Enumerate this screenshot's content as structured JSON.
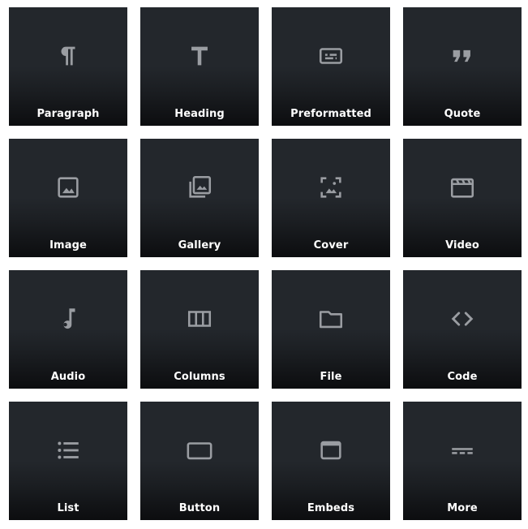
{
  "colors": {
    "tile_background": "#23272c",
    "tile_background_bottom": "#0c0d0f",
    "icon": "#9a9da2",
    "label": "#ffffff"
  },
  "blocks": [
    {
      "label": "Paragraph",
      "icon": "paragraph-icon"
    },
    {
      "label": "Heading",
      "icon": "heading-icon"
    },
    {
      "label": "Preformatted",
      "icon": "preformatted-icon"
    },
    {
      "label": "Quote",
      "icon": "quote-icon"
    },
    {
      "label": "Image",
      "icon": "image-icon"
    },
    {
      "label": "Gallery",
      "icon": "gallery-icon"
    },
    {
      "label": "Cover",
      "icon": "cover-icon"
    },
    {
      "label": "Video",
      "icon": "video-icon"
    },
    {
      "label": "Audio",
      "icon": "audio-icon"
    },
    {
      "label": "Columns",
      "icon": "columns-icon"
    },
    {
      "label": "File",
      "icon": "file-icon"
    },
    {
      "label": "Code",
      "icon": "code-icon"
    },
    {
      "label": "List",
      "icon": "list-icon"
    },
    {
      "label": "Button",
      "icon": "button-icon"
    },
    {
      "label": "Embeds",
      "icon": "embeds-icon"
    },
    {
      "label": "More",
      "icon": "more-icon"
    }
  ]
}
